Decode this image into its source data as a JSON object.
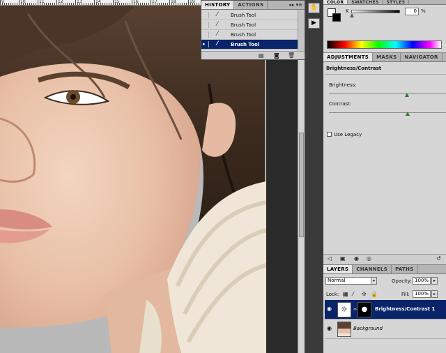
{
  "ruler": {
    "numbers": [
      "9",
      "10",
      "11",
      "12",
      "13",
      "14",
      "15",
      "16",
      "17",
      "18",
      "19"
    ]
  },
  "history": {
    "tabs": [
      "HISTORY",
      "ACTIONS"
    ],
    "items": [
      {
        "label": "Brush Tool",
        "selected": false
      },
      {
        "label": "Brush Tool",
        "selected": false
      },
      {
        "label": "Brush Tool",
        "selected": false
      },
      {
        "label": "Brush Tool",
        "selected": true
      }
    ]
  },
  "color": {
    "tabs": [
      "COLOR",
      "SWATCHES",
      "STYLES"
    ],
    "k_label": "K",
    "k_value": "0",
    "k_unit": "%"
  },
  "adjustments": {
    "tabs": [
      "ADJUSTMENTS",
      "MASKS",
      "NAVIGATOR"
    ],
    "title": "Brightness/Contrast",
    "brightness_label": "Brightness:",
    "contrast_label": "Contrast:",
    "legacy_label": "Use Legacy"
  },
  "layers": {
    "tabs": [
      "LAYERS",
      "CHANNELS",
      "PATHS"
    ],
    "blend_mode": "Normal",
    "opacity_label": "Opacity:",
    "opacity_value": "100%",
    "lock_label": "Lock:",
    "fill_label": "Fill:",
    "fill_value": "100%",
    "items": [
      {
        "name": "Brightness/Contrast 1",
        "selected": true
      },
      {
        "name": "Background",
        "selected": false
      }
    ]
  },
  "colors": {
    "selection": "#0a246a",
    "panel": "#d6d6d6",
    "accent_green": "#2a7a2a"
  }
}
